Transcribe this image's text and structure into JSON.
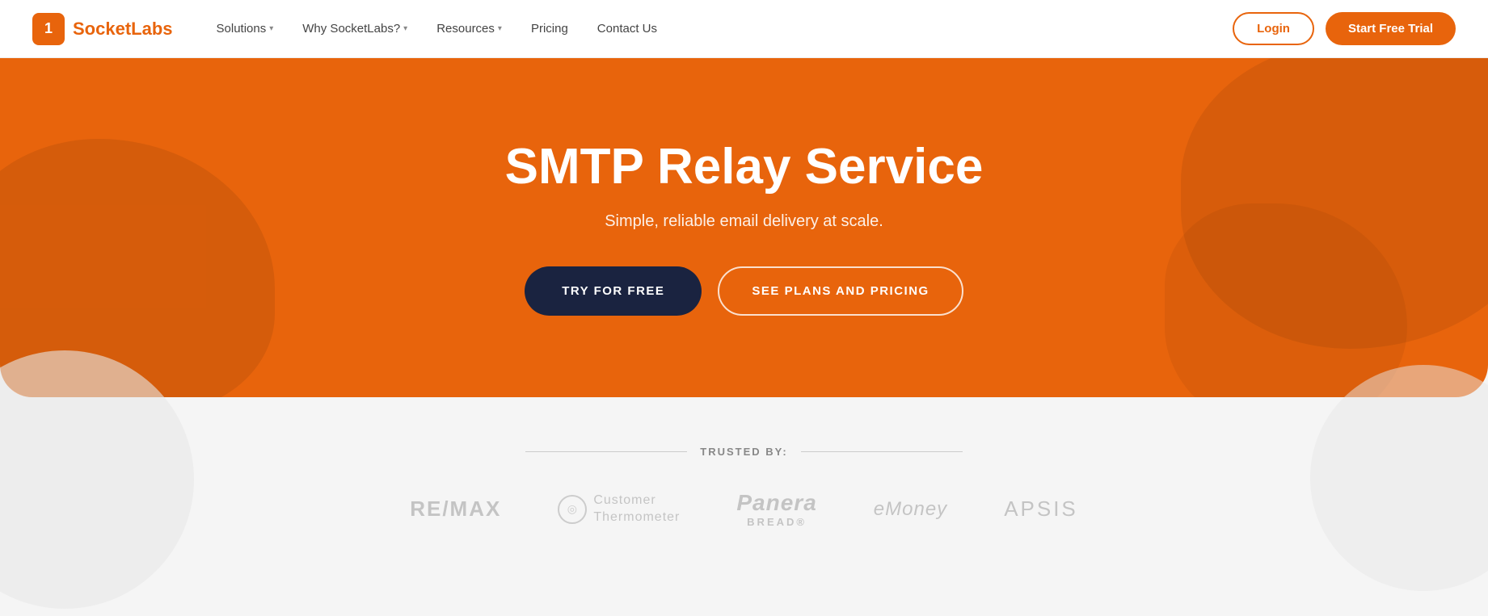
{
  "navbar": {
    "logo_letter": "1",
    "logo_socket": "Socket",
    "logo_labs": "Labs",
    "nav_solutions": "Solutions",
    "nav_why": "Why SocketLabs?",
    "nav_resources": "Resources",
    "nav_pricing": "Pricing",
    "nav_contact": "Contact Us",
    "btn_login": "Login",
    "btn_trial": "Start Free Trial"
  },
  "hero": {
    "title": "SMTP Relay Service",
    "subtitle": "Simple, reliable email delivery at scale.",
    "btn_try": "TRY FOR FREE",
    "btn_plans": "SEE PLANS AND PRICING"
  },
  "trusted": {
    "label": "TRUSTED BY:",
    "logos": [
      {
        "id": "remax",
        "text": "RE/MAX"
      },
      {
        "id": "ctherm",
        "icon": "◎",
        "line1": "Customer",
        "line2": "Thermometer"
      },
      {
        "id": "panera",
        "main": "Panera",
        "sub": "BREAD"
      },
      {
        "id": "emoney",
        "prefix": "e",
        "rest": "Money"
      },
      {
        "id": "apsis",
        "text": "APSIS"
      }
    ]
  }
}
